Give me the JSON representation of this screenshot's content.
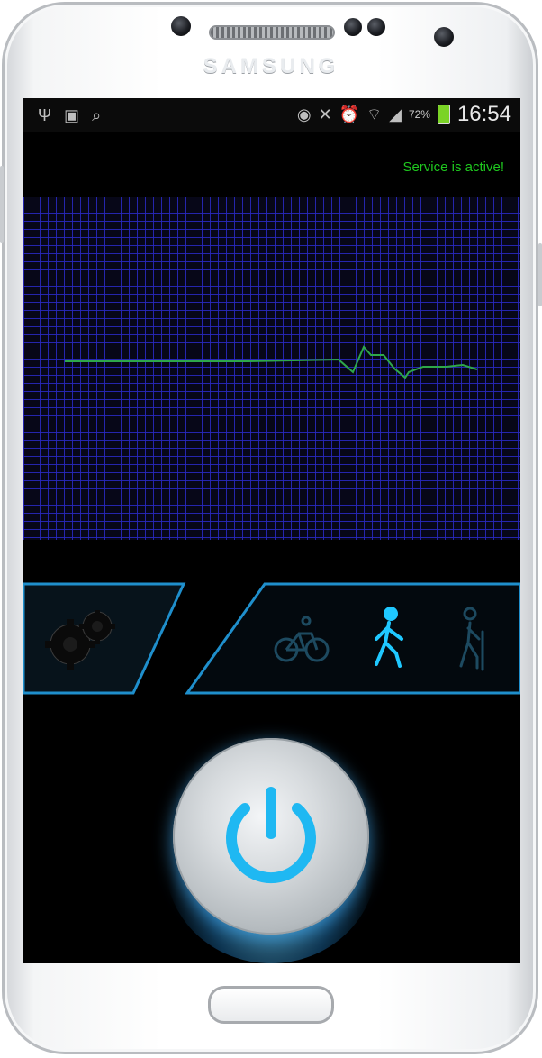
{
  "device": {
    "brand": "SAMSUNG"
  },
  "status_bar": {
    "left_icons": [
      "usb-icon",
      "image-icon",
      "search-icon"
    ],
    "right_icons": [
      "eye-icon",
      "mute-icon",
      "alarm-icon",
      "wifi-icon",
      "signal-icon"
    ],
    "battery_percent": "72%",
    "battery_color": "#7ad326",
    "time": "16:54"
  },
  "app": {
    "service_status": "Service is active!",
    "accent_color": "#1fc8ff",
    "graph_line_color": "#2ea84a",
    "modes": [
      {
        "name": "cycling",
        "icon": "bicycle-icon",
        "selected": false
      },
      {
        "name": "walking",
        "icon": "walking-person-icon",
        "selected": true
      },
      {
        "name": "hiking",
        "icon": "hiking-person-icon",
        "selected": false
      }
    ],
    "settings_icon": "gears-icon",
    "power_icon": "power-icon",
    "power_state": "on"
  }
}
